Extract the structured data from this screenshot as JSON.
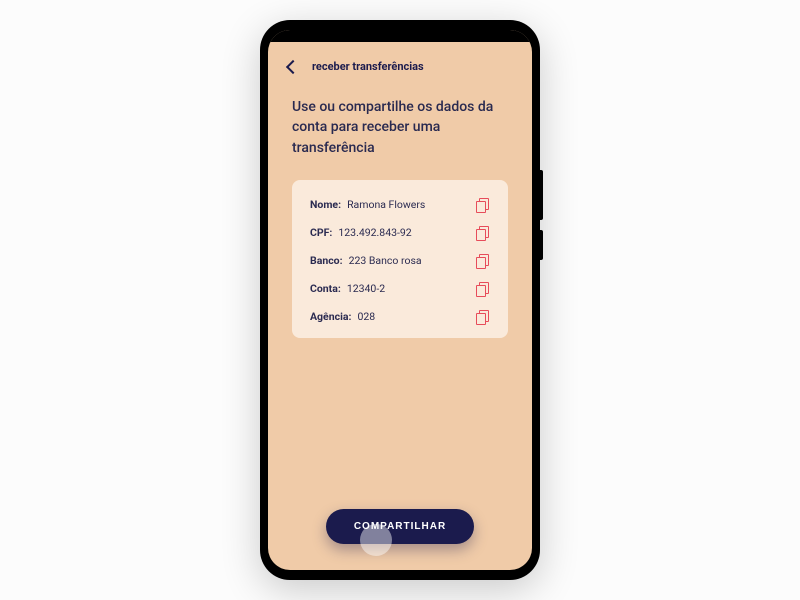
{
  "header": {
    "title": "receber transferências"
  },
  "instruction": "Use ou compartilhe os dados da conta para receber uma transferência",
  "fields": [
    {
      "label": "Nome:",
      "value": "Ramona Flowers"
    },
    {
      "label": "CPF:",
      "value": "123.492.843-92"
    },
    {
      "label": "Banco:",
      "value": "223 Banco rosa"
    },
    {
      "label": "Conta:",
      "value": "12340-2"
    },
    {
      "label": "Agência:",
      "value": "028"
    }
  ],
  "share_button": "COMPARTILHAR",
  "colors": {
    "screen_bg": "#f0cba8",
    "card_bg": "#faeadb",
    "primary": "#1b1b4d",
    "accent": "#e74c5a"
  }
}
